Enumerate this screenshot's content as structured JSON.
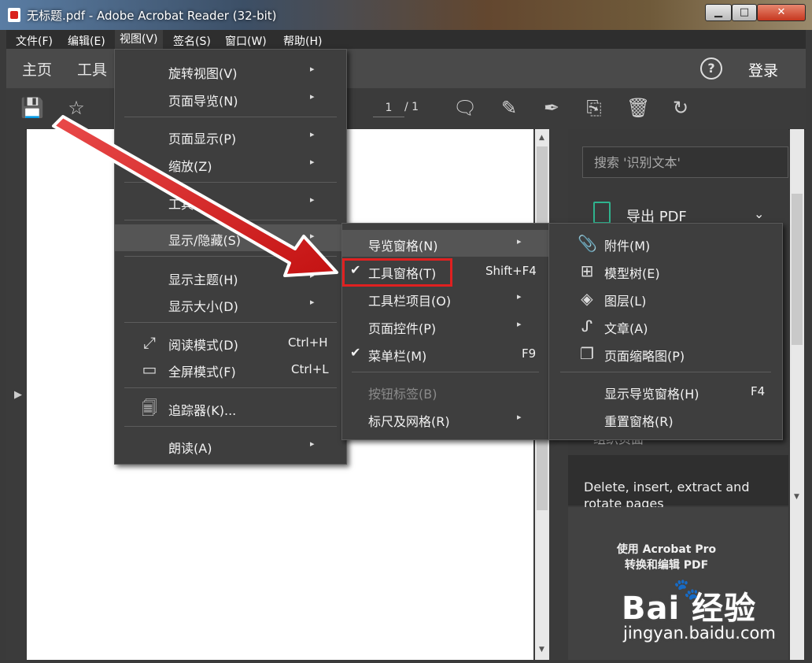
{
  "window": {
    "title": "无标题.pdf - Adobe Acrobat Reader (32-bit)",
    "min": "▁",
    "max": "□",
    "close": "✕"
  },
  "menubar": [
    "文件(F)",
    "编辑(E)",
    "视图(V)",
    "签名(S)",
    "窗口(W)",
    "帮助(H)"
  ],
  "nav": {
    "home": "主页",
    "tools": "工具",
    "login": "登录",
    "help": "?"
  },
  "toolbar": {
    "page_current": "1",
    "page_total": "/ 1"
  },
  "view_menu": {
    "items": [
      {
        "label": "旋转视图(V)",
        "submenu": true
      },
      {
        "label": "页面导览(N)",
        "submenu": true
      },
      {
        "label": "页面显示(P)",
        "submenu": true
      },
      {
        "label": "缩放(Z)",
        "submenu": true
      },
      {
        "label": "工具(T)",
        "submenu": true
      },
      {
        "label": "显示/隐藏(S)",
        "submenu": true
      },
      {
        "label": "显示主题(H)",
        "submenu": true
      },
      {
        "label": "显示大小(D)",
        "submenu": true
      },
      {
        "label": "阅读模式(D)",
        "shortcut": "Ctrl+H"
      },
      {
        "label": "全屏模式(F)",
        "shortcut": "Ctrl+L"
      },
      {
        "label": "追踪器(K)..."
      },
      {
        "label": "朗读(A)",
        "submenu": true
      }
    ]
  },
  "showhide_menu": {
    "items": [
      {
        "label": "导览窗格(N)",
        "submenu": true
      },
      {
        "label": "工具窗格(T)",
        "shortcut": "Shift+F4",
        "checked": true
      },
      {
        "label": "工具栏项目(O)",
        "submenu": true
      },
      {
        "label": "页面控件(P)",
        "submenu": true
      },
      {
        "label": "菜单栏(M)",
        "shortcut": "F9",
        "checked": true
      },
      {
        "label": "按钮标签(B)",
        "disabled": true
      },
      {
        "label": "标尺及网格(R)",
        "submenu": true
      }
    ]
  },
  "navpane_menu": {
    "items": [
      {
        "label": "附件(M)"
      },
      {
        "label": "模型树(E)"
      },
      {
        "label": "图层(L)"
      },
      {
        "label": "文章(A)"
      },
      {
        "label": "页面缩略图(P)"
      },
      {
        "label": "显示导览窗格(H)",
        "shortcut": "F4"
      },
      {
        "label": "重置窗格(R)"
      }
    ]
  },
  "right_panel": {
    "search_placeholder": "搜索 '识别文本'",
    "export_label": "导出 PDF",
    "hidden_item": "组织页面",
    "description": "Delete, insert, extract and rotate pages",
    "promo_line1": "使用 Acrobat Pro",
    "promo_line2": "转换和编辑 PDF"
  },
  "watermark": {
    "logo": "Bai  经验",
    "url": "jingyan.baidu.com"
  },
  "colors": {
    "highlight_box": "#e02020",
    "arrow": "#d81f1f",
    "export_icon": "#2fb38e"
  }
}
